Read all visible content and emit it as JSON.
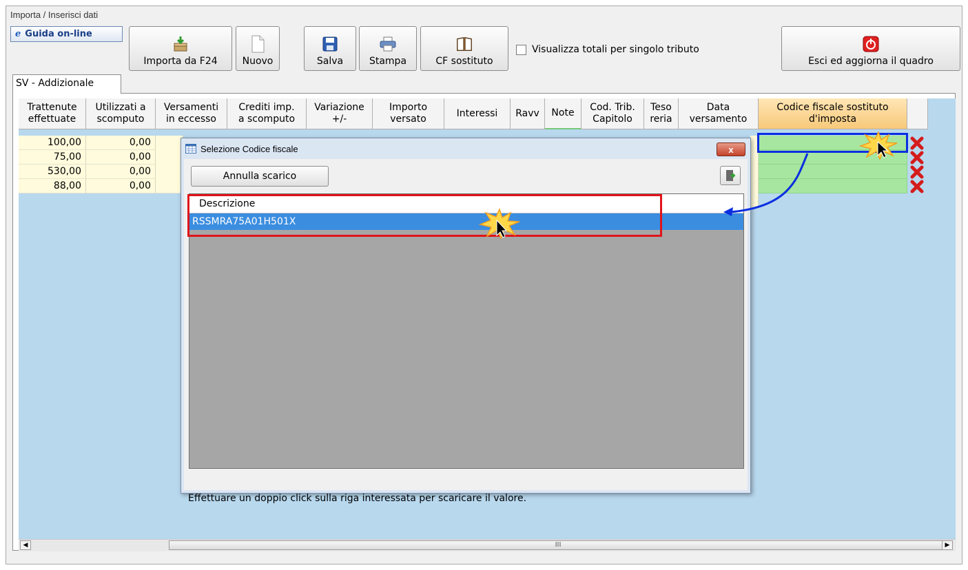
{
  "window": {
    "title": "Importa / Inserisci dati"
  },
  "toolbar": {
    "guida_icon": "e",
    "guida_label": "Guida on-line",
    "importa_label": "Importa da F24",
    "nuovo_label": "Nuovo",
    "salva_label": "Salva",
    "stampa_label": "Stampa",
    "cf_label": "CF sostituto",
    "checkbox_label": "Visualizza totali per singolo tributo",
    "esci_label": "Esci ed aggiorna il quadro"
  },
  "tab": {
    "label": "SV - Addizionale"
  },
  "grid": {
    "headers": [
      "Trattenute\neffettuate",
      "Utilizzati a\nscomputo",
      "Versamenti\nin eccesso",
      "Crediti imp.\na scomputo",
      "Variazione\n+/-",
      "Importo\nversato",
      "Interessi",
      "Ravv",
      "Note",
      "Cod. Trib.\nCapitolo",
      "Teso\nreria",
      "Data\nversamento",
      "Codice fiscale sostituto\nd'imposta"
    ],
    "rows": [
      {
        "trattenute": "100,00",
        "utilizzati": "0,00"
      },
      {
        "trattenute": "75,00",
        "utilizzati": "0,00"
      },
      {
        "trattenute": "530,00",
        "utilizzati": "0,00"
      },
      {
        "trattenute": "88,00",
        "utilizzati": "0,00"
      }
    ]
  },
  "dialog": {
    "title": "Selezione Codice fiscale",
    "close_label": "x",
    "annulla_label": "Annulla scarico",
    "list_header": "Descrizione",
    "list_items": [
      "RSSMRA75A01H501X"
    ],
    "hint": "Effettuare un doppio click sulla riga interessata per scaricare il valore."
  },
  "scrollbar": {
    "thumb_grip": "III"
  },
  "colors": {
    "grid_bg": "#b8d8ee",
    "cell_yellow": "#fffbdc",
    "cell_green": "#a6e6a0",
    "selected_row": "#3b8de0",
    "highlight_red": "#e0141a",
    "highlight_blue": "#0a2ee0"
  }
}
